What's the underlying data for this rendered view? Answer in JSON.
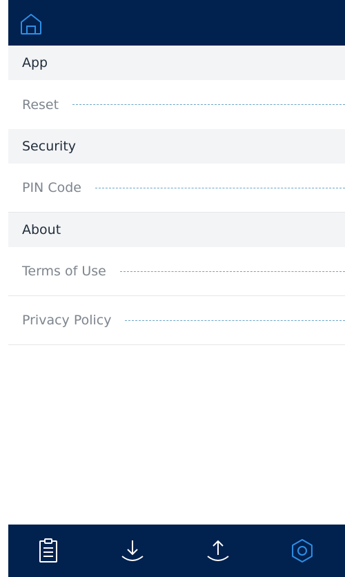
{
  "header": {
    "home_icon": "home-icon"
  },
  "sections": [
    {
      "title": "App",
      "items": [
        {
          "label": "Reset"
        }
      ]
    },
    {
      "title": "Security",
      "items": [
        {
          "label": "PIN Code"
        }
      ]
    },
    {
      "title": "About",
      "items": [
        {
          "label": "Terms of Use"
        },
        {
          "label": "Privacy Policy"
        }
      ]
    }
  ],
  "tabs": [
    {
      "icon": "clipboard-icon",
      "active": false
    },
    {
      "icon": "download-icon",
      "active": false
    },
    {
      "icon": "upload-icon",
      "active": false
    },
    {
      "icon": "settings-icon",
      "active": true
    }
  ],
  "colors": {
    "navy": "#01214f",
    "icon_inactive": "#ffffff",
    "icon_active": "#2f8fe6",
    "section_bg": "#f3f4f6",
    "dash": "#6aa4c8"
  }
}
